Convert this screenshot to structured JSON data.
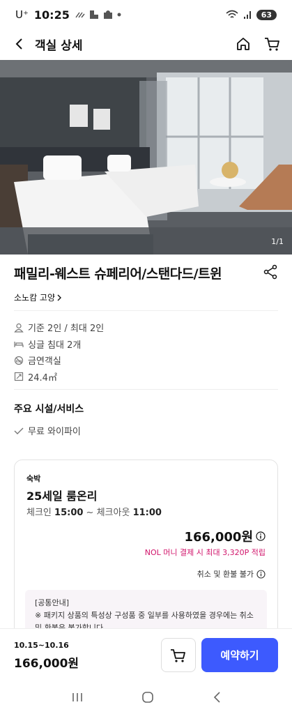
{
  "status_bar": {
    "carrier": "U⁺",
    "time": "10:25",
    "battery": "63"
  },
  "header": {
    "title": "객실 상세"
  },
  "hero": {
    "counter": "1/1"
  },
  "room": {
    "title": "패밀리-웨스트 슈페리어/스탠다드/트윈",
    "hotel": "소노캄 고양",
    "features": [
      {
        "icon": "person-icon",
        "label": "기준 2인 / 최대 2인"
      },
      {
        "icon": "bed-icon",
        "label": "싱글 침대 2개"
      },
      {
        "icon": "no-smoking-icon",
        "label": "금연객실"
      },
      {
        "icon": "area-icon",
        "label": "24.4㎡"
      }
    ],
    "amenities_title": "주요 시설/서비스",
    "amenities": [
      "무료 와이파이"
    ]
  },
  "offer": {
    "category": "숙박",
    "name": "25세일 룸온리",
    "checkin_label": "체크인",
    "checkin_time": "15:00",
    "separator": " ~ ",
    "checkout_label": "체크아웃",
    "checkout_time": "11:00",
    "price": "166,000원",
    "points": "NOL 머니 결제 시 최대 3,320P 적립",
    "refund": "취소 및 환불 불가",
    "notice_title": "[공통안내]",
    "notice_text": "※ 패키지 상품의 특성상 구성품 중 일부를 사용하였을 경우에는 취소 및 환불은 불가합니다."
  },
  "bottom": {
    "dates": "10.15~10.16",
    "price": "166,000원",
    "reserve_label": "예약하기"
  },
  "colors": {
    "accent": "#3d5afe",
    "points": "#d1156b"
  }
}
